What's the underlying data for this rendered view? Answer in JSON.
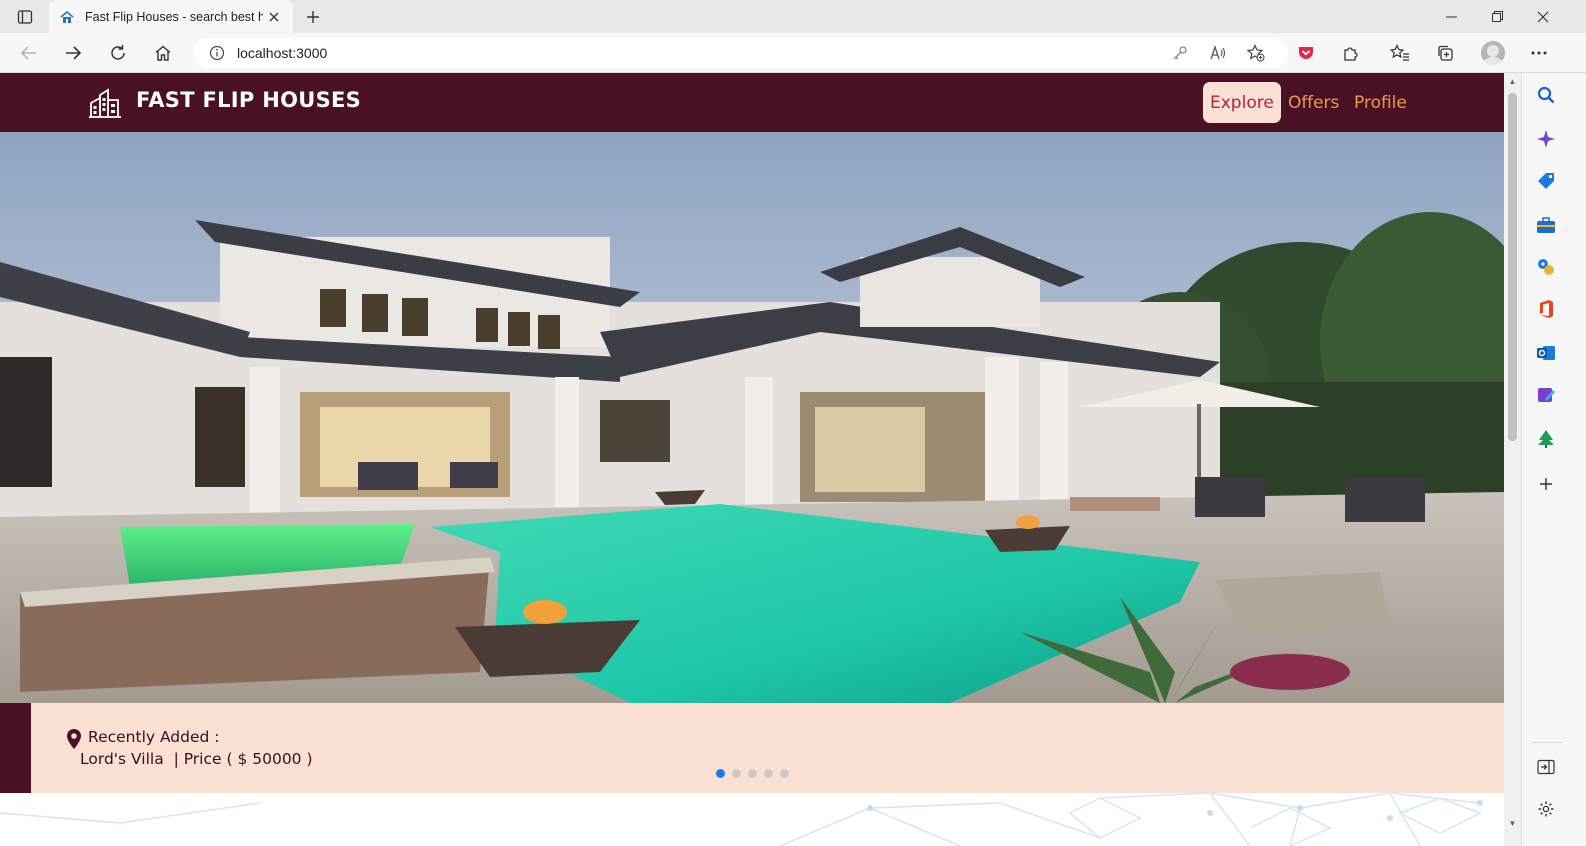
{
  "browser": {
    "tab_title": "Fast Flip Houses - search best ho",
    "url": "localhost:3000"
  },
  "site": {
    "brand": "FAST FLIP HOUSES",
    "nav": [
      {
        "label": "Explore",
        "active": true
      },
      {
        "label": "Offers",
        "active": false
      },
      {
        "label": "Profile",
        "active": false
      }
    ],
    "colors": {
      "header_bg": "#4a1023",
      "nav_link": "#e89a4c",
      "nav_active_bg": "#fbe1d3",
      "nav_active_text": "#b0243f",
      "info_bar_bg": "#fbe1d3",
      "carousel_active_dot": "#1677ff"
    }
  },
  "listing": {
    "recent_label": "Recently Added :",
    "recent_value": "Lord's Villa  | Price ( $ 50000 )"
  },
  "carousel": {
    "slide_count": 5,
    "active_index": 0
  }
}
